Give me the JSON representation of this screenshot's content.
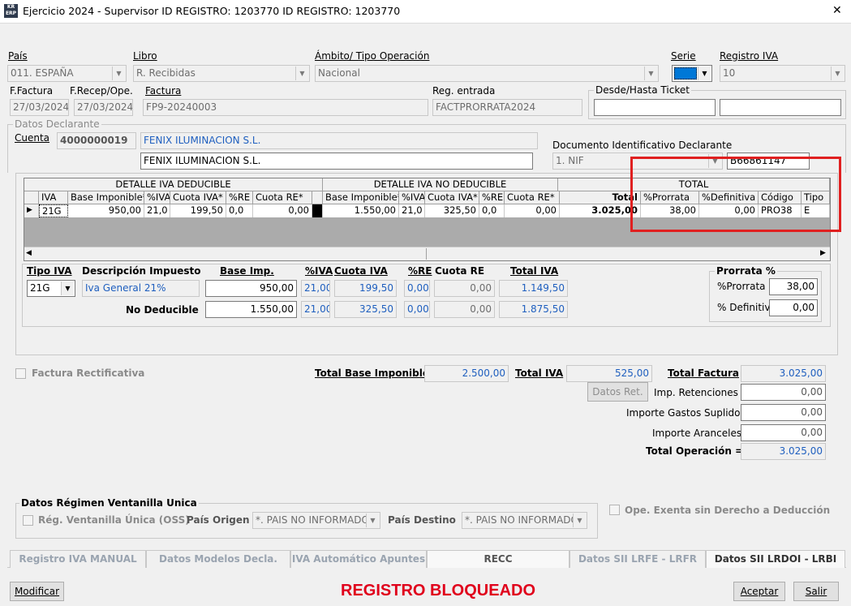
{
  "window": {
    "title": "Ejercicio 2024 - Supervisor ID REGISTRO: 1203770  ID REGISTRO: 1203770",
    "app_icon": "KR ERP",
    "close": "✕"
  },
  "top": {
    "pais_label": "País",
    "pais_value": "011.  ESPAÑA",
    "libro_label": "Libro",
    "libro_value": "R. Recibidas",
    "ambito_label": "Ámbito/ Tipo Operación",
    "ambito_value": "Nacional",
    "serie_label": "Serie",
    "serie_color": "#0078d7",
    "registro_label": "Registro IVA",
    "registro_value": "10",
    "ffactura_label": "F.Factura",
    "ffactura_value": "27/03/2024",
    "frecep_label": "F.Recep/Ope.",
    "frecep_value": "27/03/2024",
    "factura_label": "Factura",
    "factura_value": "FP9-20240003",
    "regentrada_label": "Reg. entrada",
    "regentrada_value": "FACTPRORRATA2024",
    "ticket_label": "Desde/Hasta Ticket",
    "declarante_legend": "Datos Declarante",
    "cuenta_label": "Cuenta",
    "cuenta_value": "4000000019",
    "cuenta_name": "FENIX ILUMINACION S.L.",
    "cuenta_name2": "FENIX ILUMINACION S.L.",
    "doc_label": "Documento Identificativo Declarante",
    "doc_type": "1. NIF",
    "doc_value": "B66861147"
  },
  "grid": {
    "group1": "DETALLE IVA DEDUCIBLE",
    "group2": "DETALLE IVA NO DEDUCIBLE",
    "group3": "TOTAL",
    "headers": [
      "IVA",
      "Base Imponible*",
      "%IVA",
      "Cuota IVA*",
      "%RE",
      "Cuota RE*",
      "Base Imponible*",
      "%IVA",
      "Cuota IVA*",
      "%RE",
      "Cuota RE*",
      "Total",
      "%Prorrata",
      "%Definitiva",
      "Código",
      "Tipo"
    ],
    "row": [
      "21G",
      "950,00",
      "21,0",
      "199,50",
      "0,0",
      "0,00",
      "1.550,00",
      "21,0",
      "325,50",
      "0,0",
      "0,00",
      "3.025,00",
      "38,00",
      "0,00",
      "PRO38",
      "E"
    ],
    "highlight_color": "#e02020"
  },
  "detail": {
    "tipo_label": "Tipo IVA",
    "desc_label": "Descripción Impuesto",
    "base_label": "Base Imp.",
    "piva_label": "%IVA",
    "cuota_label": "Cuota IVA",
    "pre_label": "%RE",
    "cuotare_label": "Cuota RE",
    "total_label": "Total IVA",
    "tipo_value": "21G",
    "desc_value": "Iva General 21%",
    "d_base": "950,00",
    "d_piva": "21,00",
    "d_cuota": "199,50",
    "d_pre": "0,00",
    "d_cuotare": "0,00",
    "d_total": "1.149,50",
    "nd_label": "No  Deducible",
    "nd_base": "1.550,00",
    "nd_piva": "21,00",
    "nd_cuota": "325,50",
    "nd_pre": "0,00",
    "nd_cuotare": "0,00",
    "nd_total": "1.875,50",
    "prorrata_legend": "Prorrata %",
    "prorrata_label": "%Prorrata",
    "prorrata_value": "38,00",
    "definitiva_label": "% Definitiva",
    "definitiva_value": "0,00"
  },
  "totals": {
    "rectificativa": "Factura Rectificativa",
    "tbase_label": "Total Base Imponible",
    "tbase_value": "2.500,00",
    "tiva_label": "Total IVA",
    "tiva_value": "525,00",
    "tfactura_label": "Total Factura",
    "tfactura_value": "3.025,00",
    "datosret": "Datos Ret.",
    "ret_label": "Imp. Retenciones +",
    "ret_value": "0,00",
    "gastos_label": "Importe Gastos Suplidos +",
    "gastos_value": "0,00",
    "aranceles_label": "Importe Aranceles +",
    "aranceles_value": "0,00",
    "toper_label": "Total Operación =",
    "toper_value": "3.025,00"
  },
  "oss": {
    "legend": "Datos Régimen Ventanilla Unica",
    "reg_label": "Rég. Ventanilla Única (OSS)",
    "origen_label": "País Origen",
    "origen_value": "*. PAIS NO INFORMADO",
    "destino_label": "País Destino",
    "destino_value": "*. PAIS NO INFORMADO",
    "exenta": "Ope. Exenta sin Derecho a Deducción"
  },
  "tabs": [
    "Registro IVA MANUAL",
    "Datos Modelos Decla.",
    "IVA Automático Apuntes",
    "RECC",
    "Datos SII  LRFE - LRFR",
    "Datos SII LRDOI - LRBI"
  ],
  "footer": {
    "modificar": "Modificar",
    "status": "REGISTRO BLOQUEADO",
    "status_color": "#e0001b",
    "aceptar": "Aceptar",
    "salir": "Salir"
  }
}
